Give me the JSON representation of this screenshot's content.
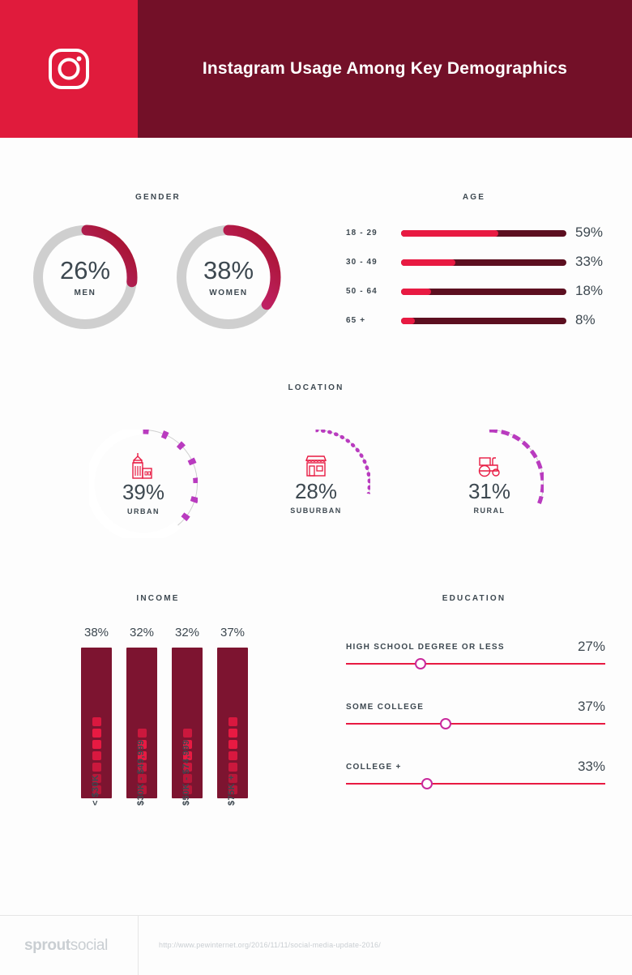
{
  "header": {
    "title": "Instagram Usage Among Key Demographics",
    "logo_icon": "instagram-icon",
    "bg_left": "#e01b3c",
    "bg_right": "#731028"
  },
  "sections": {
    "gender": "GENDER",
    "age": "AGE",
    "location": "LOCATION",
    "income": "INCOME",
    "education": "EDUCATION"
  },
  "gender": {
    "items": [
      {
        "value": "26%",
        "label": "MEN",
        "pct": 26
      },
      {
        "value": "38%",
        "label": "WOMEN",
        "pct": 38
      }
    ]
  },
  "age": {
    "items": [
      {
        "label": "18 - 29",
        "value": "59%",
        "pct": 59
      },
      {
        "label": "30 - 49",
        "value": "33%",
        "pct": 33
      },
      {
        "label": "50 - 64",
        "value": "18%",
        "pct": 18
      },
      {
        "label": "65 +",
        "value": "8%",
        "pct": 8
      }
    ]
  },
  "location": {
    "items": [
      {
        "value": "39%",
        "label": "URBAN",
        "pct": 39,
        "icon": "city-buildings-icon",
        "style": "ticks"
      },
      {
        "value": "28%",
        "label": "SUBURBAN",
        "pct": 28,
        "icon": "shop-storefront-icon",
        "style": "dots"
      },
      {
        "value": "31%",
        "label": "RURAL",
        "pct": 31,
        "icon": "tractor-icon",
        "style": "dashes"
      }
    ]
  },
  "income": {
    "items": [
      {
        "value": "38%",
        "label": "< $30K",
        "pct": 38,
        "squares": 7
      },
      {
        "value": "32%",
        "label": "$30K - $49,999",
        "pct": 32,
        "squares": 6
      },
      {
        "value": "32%",
        "label": "$50K - $74,999",
        "pct": 32,
        "squares": 6
      },
      {
        "value": "37%",
        "label": "$75K +",
        "pct": 37,
        "squares": 7
      }
    ]
  },
  "education": {
    "items": [
      {
        "label": "HIGH SCHOOL DEGREE OR LESS",
        "value": "27%",
        "pct": 27
      },
      {
        "label": "SOME COLLEGE",
        "value": "37%",
        "pct": 37
      },
      {
        "label": "COLLEGE +",
        "value": "33%",
        "pct": 33
      }
    ]
  },
  "footer": {
    "logo_bold": "sprout",
    "logo_light": "social",
    "source_url": "http://www.pewinternet.org/2016/11/11/social-media-update-2016/"
  },
  "colors": {
    "crimson": "#e01b3c",
    "maroon": "#731028",
    "bar_red": "#e81a42",
    "bar_track": "#5c0f20",
    "purple": "#8b2f9e",
    "magenta": "#c9299c",
    "text": "#3d4850",
    "ring_gray": "#cfcfcf"
  },
  "chart_data": [
    {
      "type": "pie",
      "title": "GENDER",
      "categories": [
        "MEN",
        "WOMEN"
      ],
      "values": [
        26,
        38
      ],
      "unit": "%"
    },
    {
      "type": "bar",
      "title": "AGE",
      "orientation": "horizontal",
      "categories": [
        "18 - 29",
        "30 - 49",
        "50 - 64",
        "65 +"
      ],
      "values": [
        59,
        33,
        18,
        8
      ],
      "xlim": [
        0,
        100
      ],
      "unit": "%"
    },
    {
      "type": "pie",
      "title": "LOCATION",
      "categories": [
        "URBAN",
        "SUBURBAN",
        "RURAL"
      ],
      "values": [
        39,
        28,
        31
      ],
      "unit": "%"
    },
    {
      "type": "bar",
      "title": "INCOME",
      "orientation": "vertical",
      "categories": [
        "< $30K",
        "$30K - $49,999",
        "$50K - $74,999",
        "$75K +"
      ],
      "values": [
        38,
        32,
        32,
        37
      ],
      "ylim": [
        0,
        100
      ],
      "unit": "%"
    },
    {
      "type": "bar",
      "title": "EDUCATION",
      "orientation": "slider",
      "categories": [
        "HIGH SCHOOL DEGREE OR LESS",
        "SOME COLLEGE",
        "COLLEGE +"
      ],
      "values": [
        27,
        37,
        33
      ],
      "xlim": [
        0,
        100
      ],
      "unit": "%"
    }
  ]
}
